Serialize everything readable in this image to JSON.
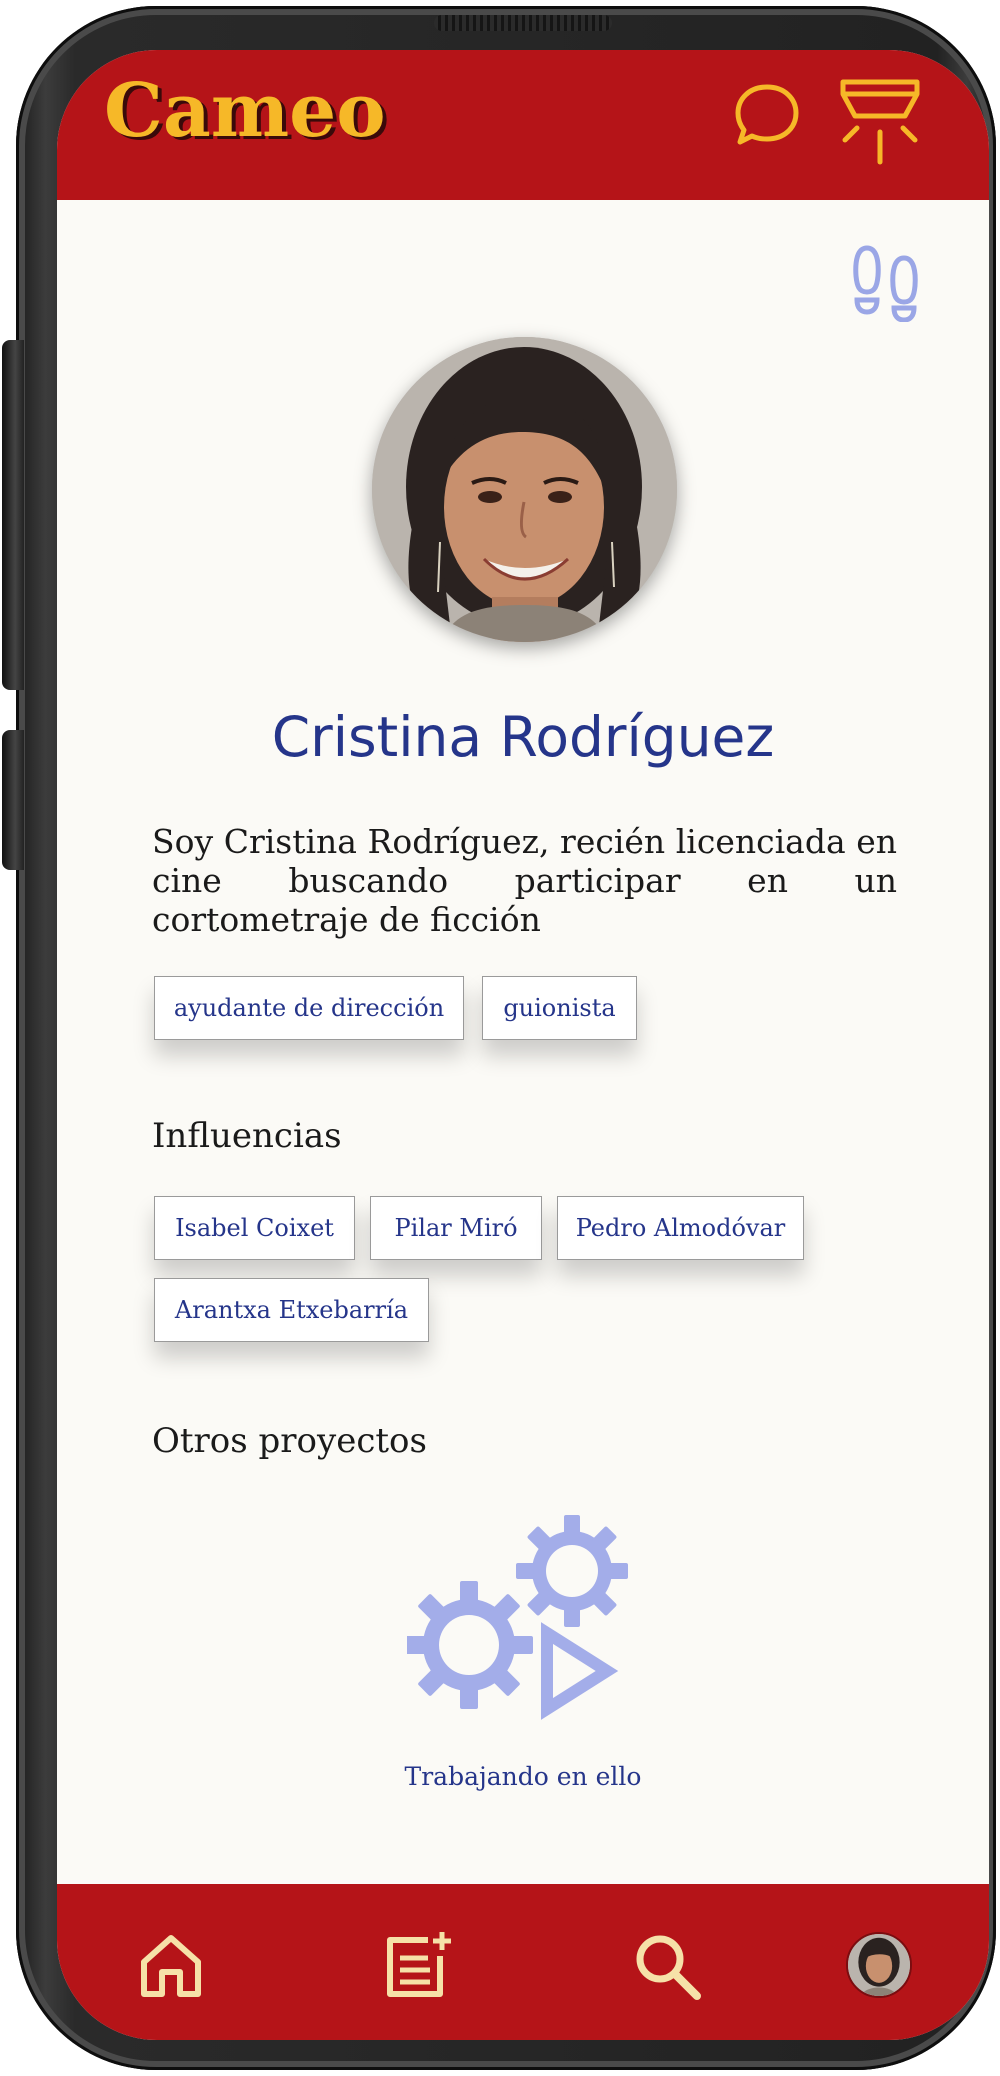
{
  "app": {
    "logo_text": "Cameo",
    "brand_color": "#b51418",
    "accent_color": "#f6b828",
    "text_color": "#25358a"
  },
  "header": {
    "icons": [
      "chat-bubble-icon",
      "ceiling-lamp-icon"
    ]
  },
  "profile": {
    "footprints_icon": "footsteps-icon",
    "name": "Cristina Rodríguez",
    "bio": "Soy Cristina Rodríguez, recién licenciada en cine buscando participar en un cortometraje de ficción",
    "roles": [
      "ayudante de dirección",
      "guionista"
    ]
  },
  "influences": {
    "title": "Influencias",
    "items": [
      "Isabel Coixet",
      "Pilar Miró",
      "Pedro Almodóvar",
      "Arantxa Etxebarría"
    ]
  },
  "projects": {
    "title": "Otros proyectos",
    "status_text": "Trabajando en ello",
    "status_icon": "gears-play-icon"
  },
  "bottom_nav": {
    "items": [
      "home-icon",
      "notes-add-icon",
      "search-icon",
      "profile-avatar"
    ]
  }
}
